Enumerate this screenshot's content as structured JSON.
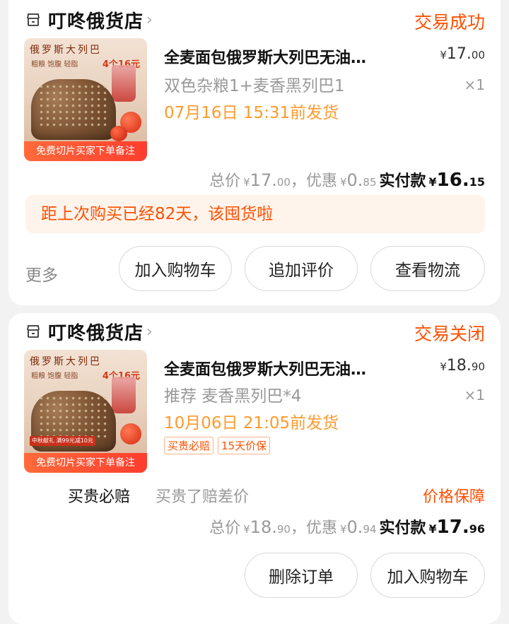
{
  "orders": [
    {
      "shop_name": "叮咚俄货店",
      "chevron": "›",
      "status": "交易成功",
      "thumb": {
        "title_text": "俄罗斯大列巴",
        "subtitle_text": "粗粮 饱腹 轻脂",
        "price_text": "4个16元",
        "banner_text": "免费切片买家下单备注"
      },
      "product_title": "全麦面包俄罗斯大列巴无油…",
      "price_yen": "¥",
      "price_int": "17.",
      "price_dec": "00",
      "spec": "双色杂粮1+麦香黑列巴1",
      "quantity": "×1",
      "ship_text": "07月16日 15:31前发货",
      "total_label": "总价",
      "total_int": "17.",
      "total_dec": "00",
      "sep": "，",
      "discount_label": "优惠",
      "discount_int": "0.",
      "discount_dec": "85",
      "pay_label": "实付款",
      "pay_int": "16.",
      "pay_dec": "15",
      "notice": "距上次购买已经82天，该囤货啦",
      "more": "更多",
      "buttons": [
        "加入购物车",
        "追加评价",
        "查看物流"
      ]
    },
    {
      "shop_name": "叮咚俄货店",
      "chevron": "›",
      "status": "交易关闭",
      "thumb": {
        "title_text": "俄罗斯大列巴",
        "subtitle_text": "粗粮 饱腹 轻脂",
        "price_text": "4个16元",
        "promo_text": "中秋献礼 满99元减10元",
        "banner_text": "免费切片买家下单备注"
      },
      "product_title": "全麦面包俄罗斯大列巴无油…",
      "price_yen": "¥",
      "price_int": "18.",
      "price_dec": "90",
      "spec": "推荐 麦香黑列巴*4",
      "quantity": "×1",
      "ship_text": "10月06日 21:05前发货",
      "tags": [
        "买贵必赔",
        "15天价保"
      ],
      "guarantee_label": "买贵必赔",
      "guarantee_desc": "买贵了赔差价",
      "guarantee_link": "价格保障",
      "total_label": "总价",
      "total_int": "18.",
      "total_dec": "90",
      "sep": "，",
      "discount_label": "优惠",
      "discount_int": "0.",
      "discount_dec": "94",
      "pay_label": "实付款",
      "pay_int": "17.",
      "pay_dec": "96",
      "buttons": [
        "删除订单",
        "加入购物车"
      ]
    }
  ],
  "colors": {
    "accent": "#ff5000",
    "ship": "#ff9a2c",
    "muted": "#999999"
  }
}
